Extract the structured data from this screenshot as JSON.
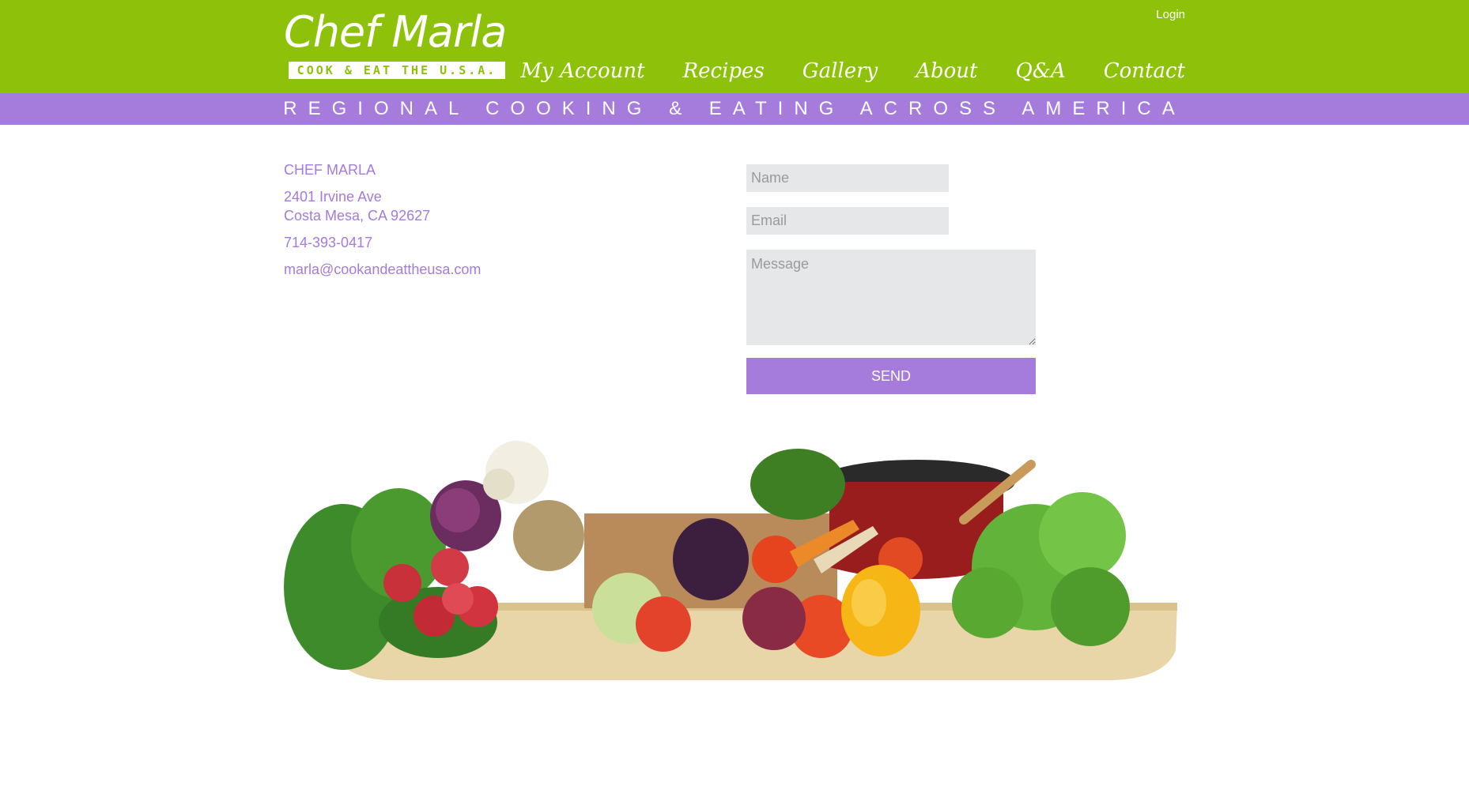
{
  "header": {
    "logo_title": "Chef Marla",
    "logo_tagline": "COOK & EAT THE U.S.A.",
    "login": "Login",
    "nav": [
      "My Account",
      "Recipes",
      "Gallery",
      "About",
      "Q&A",
      "Contact"
    ]
  },
  "band": {
    "text": "REGIONAL COOKING & EATING ACROSS AMERICA"
  },
  "contact": {
    "name": "CHEF MARLA",
    "address_line1": "2401 Irvine Ave",
    "address_line2": "Costa Mesa, CA 92627",
    "phone": "714-393-0417",
    "email": "marla@cookandeattheusa.com"
  },
  "form": {
    "name_placeholder": "Name",
    "email_placeholder": "Email",
    "message_placeholder": "Message",
    "send_label": "SEND"
  },
  "colors": {
    "green": "#8dc10a",
    "purple": "#a57bdc",
    "field": "#e6e7e8"
  }
}
